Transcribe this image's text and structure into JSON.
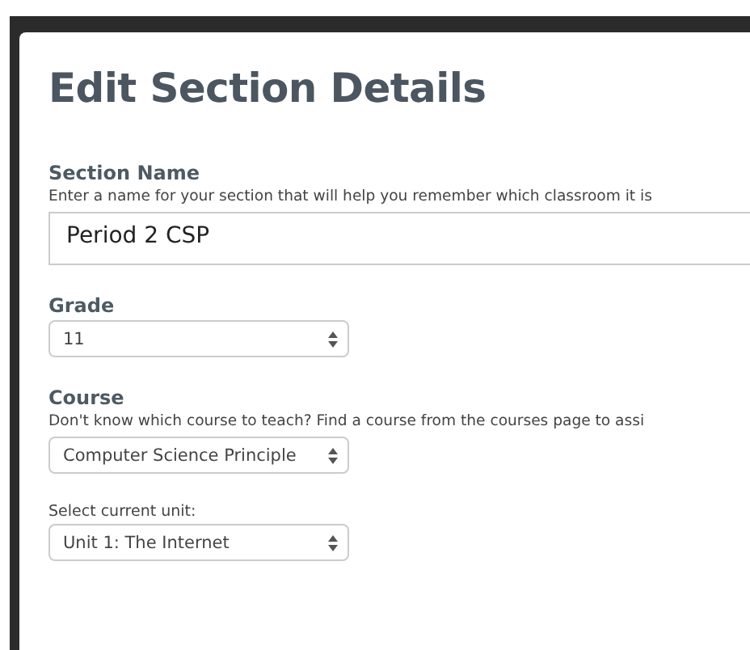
{
  "dialog": {
    "title": "Edit Section Details",
    "fields": [
      {
        "kind": "text",
        "label": "Section Name",
        "help": "Enter a name for your section that will help you remember which classroom it is",
        "value": "Period 2 CSP"
      },
      {
        "kind": "select",
        "label": "Grade",
        "value": "11"
      },
      {
        "kind": "select",
        "label": "Course",
        "help": "Don't know which course to teach? Find a course from the courses page to assi",
        "value": "Computer Science Principle"
      },
      {
        "kind": "select",
        "sublabel": "Select current unit:",
        "value": "Unit 1: The Internet"
      }
    ]
  }
}
